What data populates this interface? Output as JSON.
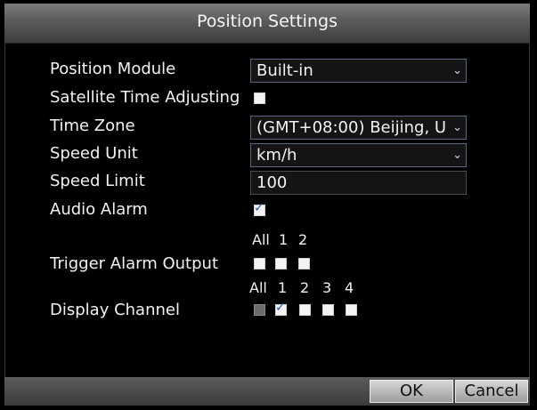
{
  "dialog": {
    "title": "Position Settings"
  },
  "fields": {
    "position_module": {
      "label": "Position Module",
      "value": "Built-in"
    },
    "satellite_time_adjusting": {
      "label": "Satellite Time Adjusting",
      "checked": false
    },
    "time_zone": {
      "label": "Time Zone",
      "value": "(GMT+08:00) Beijing, U"
    },
    "speed_unit": {
      "label": "Speed Unit",
      "value": "km/h"
    },
    "speed_limit": {
      "label": "Speed Limit",
      "value": "100"
    },
    "audio_alarm": {
      "label": "Audio Alarm",
      "checked": true
    }
  },
  "trigger_alarm_output": {
    "label": "Trigger Alarm Output",
    "headers": [
      "All",
      "1",
      "2"
    ],
    "checked": [
      false,
      false,
      false
    ]
  },
  "display_channel": {
    "label": "Display Channel",
    "headers": [
      "All",
      "1",
      "2",
      "3",
      "4"
    ],
    "checked": [
      false,
      true,
      false,
      false,
      false
    ]
  },
  "buttons": {
    "ok": "OK",
    "cancel": "Cancel"
  },
  "colors": {
    "background": "#000000",
    "titlebar": "#5a5a5a",
    "text": "#f2f2f2",
    "checkmark": "#2556d8",
    "button": "#c0c0c0"
  }
}
